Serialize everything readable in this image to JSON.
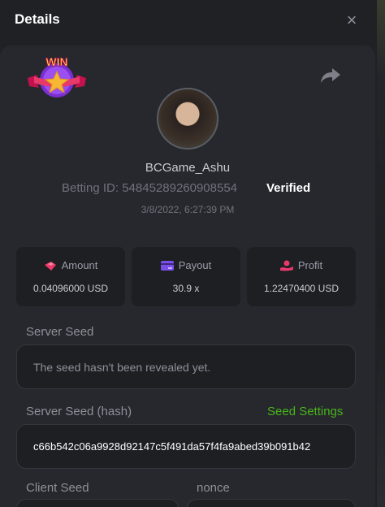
{
  "dialog": {
    "title": "Details",
    "close_label": "×"
  },
  "badge": {
    "text": "WIN"
  },
  "player": {
    "username": "BCGame_Ashu",
    "betting_id_label": "Betting ID: ",
    "betting_id": "54845289260908554",
    "verified_label": "Verified",
    "datetime": "3/8/2022, 6:27:39 PM"
  },
  "stats": [
    {
      "label": "Amount",
      "value": "0.04096000 USD",
      "icon": "coins-icon",
      "color": "#e8396b"
    },
    {
      "label": "Payout",
      "value": "30.9 x",
      "icon": "card-icon",
      "color": "#7a4fe6"
    },
    {
      "label": "Profit",
      "value": "1.22470400 USD",
      "icon": "hand-coin-icon",
      "color": "#e8396b"
    }
  ],
  "server_seed": {
    "label": "Server Seed",
    "value": "The seed hasn't been revealed yet."
  },
  "server_seed_hash": {
    "label": "Server Seed (hash)",
    "link": "Seed Settings",
    "value": "c66b542c06a9928d92147c5f491da57f4fa9abed39b091b42"
  },
  "client_seed": {
    "label": "Client Seed"
  },
  "nonce": {
    "label": "nonce"
  },
  "colors": {
    "accent_green": "#49b51a",
    "background": "#1f2125",
    "panel": "#26282d"
  }
}
